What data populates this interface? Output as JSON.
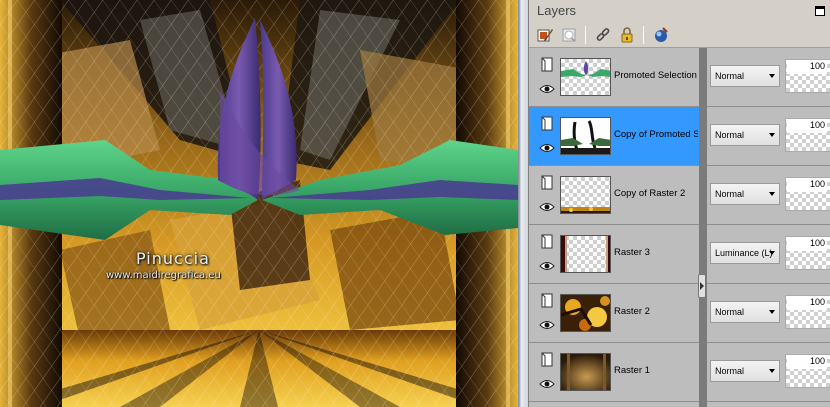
{
  "canvas": {
    "watermark_name": "Pinuccia",
    "watermark_url": "www.maidiregrafica.eu"
  },
  "palette": {
    "title": "Layers",
    "toolbar_icons": [
      "new-layer-brush-icon",
      "new-mask-icon",
      "link-icon",
      "lock-icon",
      "layer-styles-icon"
    ]
  },
  "layers": [
    {
      "name": "Promoted Selection",
      "blend_mode": "Normal",
      "opacity": "100",
      "selected": false,
      "thumb": "promoted"
    },
    {
      "name": "Copy of Promoted S",
      "blend_mode": "Normal",
      "opacity": "100",
      "selected": true,
      "thumb": "copy-promoted"
    },
    {
      "name": "Copy of Raster 2",
      "blend_mode": "Normal",
      "opacity": "100",
      "selected": false,
      "thumb": "copy-raster2"
    },
    {
      "name": "Raster 3",
      "blend_mode": "Luminance (L)",
      "opacity": "100",
      "selected": false,
      "thumb": "raster3"
    },
    {
      "name": "Raster 2",
      "blend_mode": "Normal",
      "opacity": "100",
      "selected": false,
      "thumb": "raster2"
    },
    {
      "name": "Raster 1",
      "blend_mode": "Normal",
      "opacity": "100",
      "selected": false,
      "thumb": "raster1"
    }
  ],
  "colors": {
    "selection": "#3399ff",
    "panel": "#d4d0c8",
    "layer_bg": "#bdbdbd"
  }
}
